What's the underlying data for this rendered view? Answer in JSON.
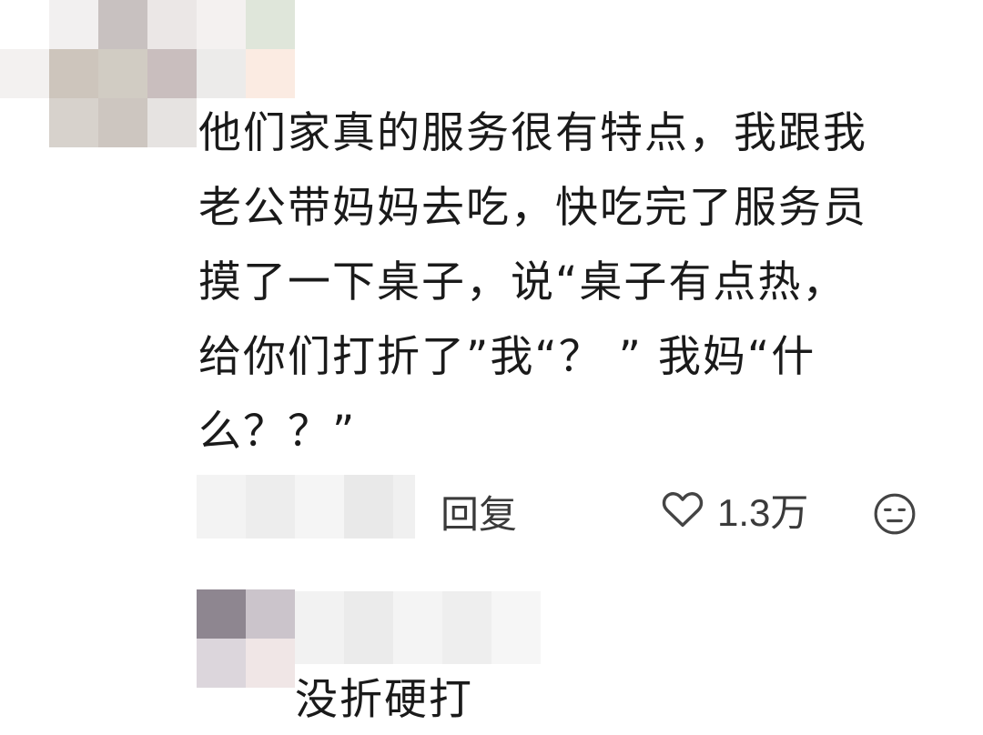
{
  "comment": {
    "lines": [
      "他们家真的服务很有特点，我跟我",
      "老公带妈妈去吃，快吃完了服务员",
      "摸了一下桌子，说“桌子有点热，",
      "给你们打折了”我“？ ” 我妈“什",
      "么？？”"
    ],
    "reply_label": "回复",
    "like_count": "1.3万",
    "icons": [
      "heart-icon",
      "emoji-icon"
    ]
  },
  "reply": {
    "text": "没折硬打"
  },
  "colors": {
    "text": "#1a1a1a",
    "secondary": "#3a3a3a",
    "icon": "#444444"
  }
}
